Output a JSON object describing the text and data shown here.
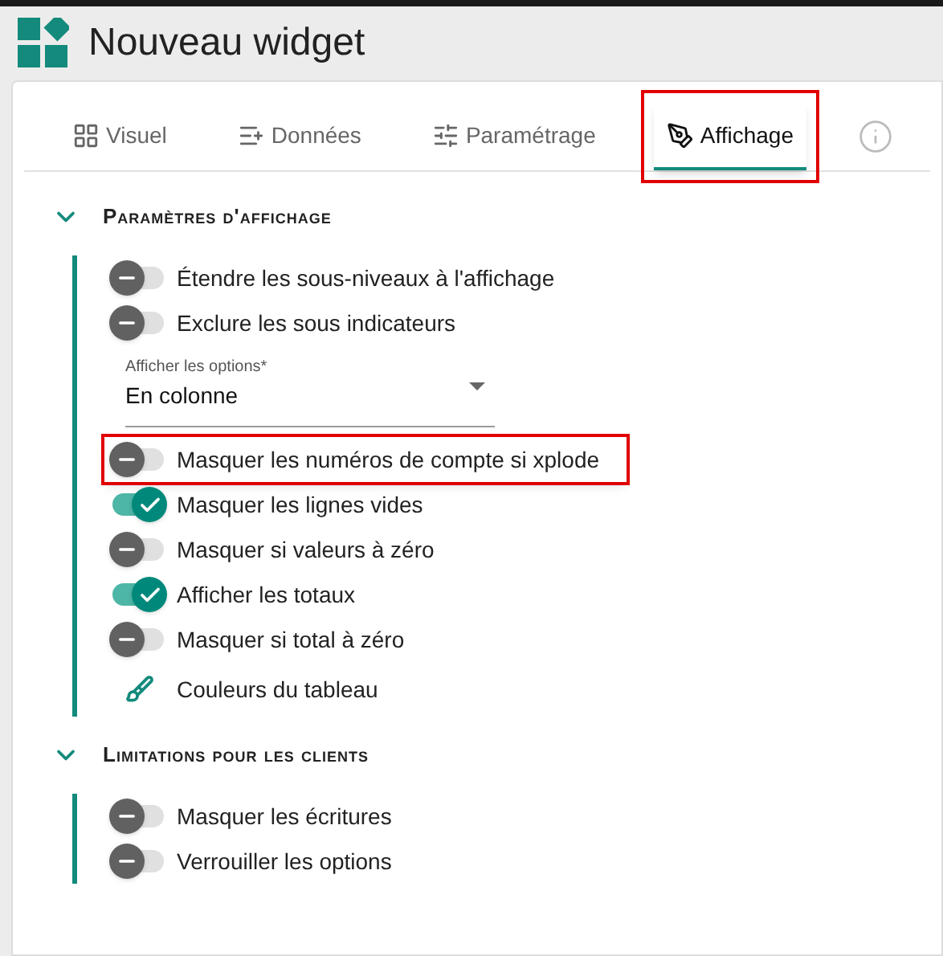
{
  "header": {
    "title": "Nouveau widget"
  },
  "tabs": [
    {
      "label": "Visuel",
      "selected": false,
      "highlighted": false
    },
    {
      "label": "Données",
      "selected": false,
      "highlighted": false
    },
    {
      "label": "Paramétrage",
      "selected": false,
      "highlighted": false
    },
    {
      "label": "Affichage",
      "selected": true,
      "highlighted": true
    }
  ],
  "sections": [
    {
      "title": "Paramètres d'affichage",
      "expanded": true,
      "items": [
        {
          "kind": "toggle",
          "label": "Étendre les sous-niveaux à l'affichage",
          "on": false,
          "highlighted": false
        },
        {
          "kind": "toggle",
          "label": "Exclure les sous indicateurs",
          "on": false,
          "highlighted": false
        },
        {
          "kind": "select",
          "label": "Afficher les options*",
          "value": "En colonne"
        },
        {
          "kind": "toggle",
          "label": "Masquer les numéros de compte si xplode",
          "on": false,
          "highlighted": true
        },
        {
          "kind": "toggle",
          "label": "Masquer les lignes vides",
          "on": true,
          "highlighted": false
        },
        {
          "kind": "toggle",
          "label": "Masquer si valeurs à zéro",
          "on": false,
          "highlighted": false
        },
        {
          "kind": "toggle",
          "label": "Afficher les totaux",
          "on": true,
          "highlighted": false
        },
        {
          "kind": "toggle",
          "label": "Masquer si total à zéro",
          "on": false,
          "highlighted": false
        },
        {
          "kind": "action",
          "label": "Couleurs du tableau"
        }
      ]
    },
    {
      "title": "Limitations pour les clients",
      "expanded": true,
      "items": [
        {
          "kind": "toggle",
          "label": "Masquer les écritures",
          "on": false,
          "highlighted": false
        },
        {
          "kind": "toggle",
          "label": "Verrouiller les options",
          "on": false,
          "highlighted": false
        }
      ]
    }
  ]
}
